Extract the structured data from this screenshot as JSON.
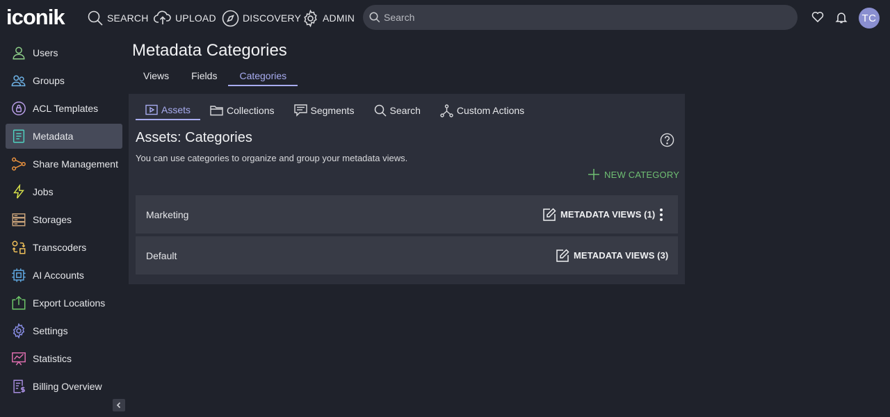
{
  "brand": {
    "logo_text": "iconik",
    "accent": "#1fa0c8"
  },
  "topnav": {
    "search_label": "SEARCH",
    "upload_label": "UPLOAD",
    "discovery_label": "DISCOVERY",
    "admin_label": "ADMIN",
    "search_placeholder": "Search",
    "avatar_initials": "TC"
  },
  "sidebar": {
    "items": [
      {
        "label": "Users",
        "icon": "user-icon"
      },
      {
        "label": "Groups",
        "icon": "users-icon"
      },
      {
        "label": "ACL Templates",
        "icon": "lock-icon"
      },
      {
        "label": "Metadata",
        "icon": "document-icon"
      },
      {
        "label": "Share Management",
        "icon": "share-icon"
      },
      {
        "label": "Jobs",
        "icon": "lightning-icon"
      },
      {
        "label": "Storages",
        "icon": "server-icon"
      },
      {
        "label": "Transcoders",
        "icon": "transcoder-icon"
      },
      {
        "label": "AI Accounts",
        "icon": "chip-icon"
      },
      {
        "label": "Export Locations",
        "icon": "export-icon"
      },
      {
        "label": "Settings",
        "icon": "gear-icon"
      },
      {
        "label": "Statistics",
        "icon": "chart-icon"
      },
      {
        "label": "Billing Overview",
        "icon": "billing-icon"
      }
    ],
    "active_index": 3
  },
  "page": {
    "title": "Metadata Categories",
    "tabs": [
      "Views",
      "Fields",
      "Categories"
    ],
    "active_tab": "Categories"
  },
  "panel": {
    "subtabs": [
      "Assets",
      "Collections",
      "Segments",
      "Search",
      "Custom Actions"
    ],
    "active_subtab": "Assets",
    "title": "Assets: Categories",
    "description": "You can use categories to organize and group your metadata views.",
    "new_category_label": "NEW CATEGORY",
    "rows": [
      {
        "name": "Marketing",
        "button": "METADATA VIEWS (1)"
      },
      {
        "name": "Default",
        "button": "METADATA VIEWS (3)"
      }
    ]
  },
  "colors": {
    "active_tab": "#a8acf0",
    "new_category": "#6fbf73",
    "panel_bg": "#2c2f3a",
    "row_bg": "#383b46"
  }
}
